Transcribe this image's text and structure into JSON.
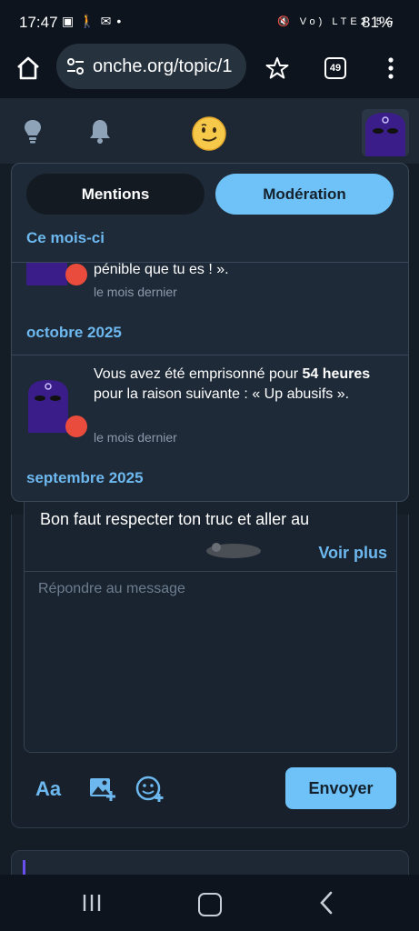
{
  "status_bar": {
    "time": "17:47",
    "left_icons": [
      "image-icon",
      "walk-icon",
      "mail-icon",
      "dot-icon"
    ],
    "right_icons": [
      "mute-icon",
      "signal-icon",
      "volte-icon",
      "5g-icon",
      "signal-icon"
    ],
    "network_labels": "Vo) LTE2 5G",
    "battery": "81%"
  },
  "browser": {
    "url": "onche.org/topic/1",
    "tab_count": "49"
  },
  "dropdown": {
    "tabs": [
      {
        "label": "Mentions",
        "active": false
      },
      {
        "label": "Modération",
        "active": true
      }
    ],
    "sections": [
      {
        "header": "Ce mois-ci"
      },
      {
        "header": "octobre 2025"
      },
      {
        "header": "septembre 2025"
      }
    ],
    "notifications": [
      {
        "text": "pénible que tu es ! ».",
        "time": "le mois dernier"
      },
      {
        "text_prefix": "Vous avez été emprisonné pour ",
        "text_bold1": "54 heures",
        "text_middle": " pour la raison suivante : « Up abusifs ».",
        "time": "le mois dernier"
      }
    ]
  },
  "post": {
    "text": "Bon faut respecter ton truc et aller au",
    "voir_plus": "Voir plus"
  },
  "reply": {
    "placeholder": "Répondre au message",
    "format_label": "Aa",
    "send_label": "Envoyer"
  },
  "colors": {
    "accent": "#6ec2f8",
    "badge": "#e94b3c",
    "background": "#141c26"
  }
}
